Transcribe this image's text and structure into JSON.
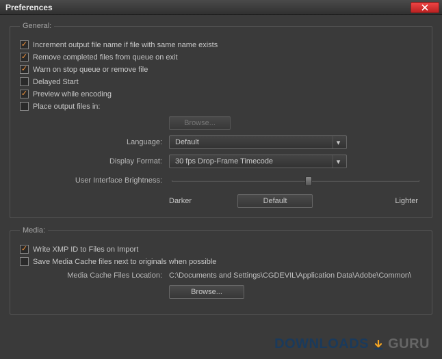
{
  "window": {
    "title": "Preferences"
  },
  "general": {
    "legend": "General:",
    "increment": {
      "label": "Increment output file name if file with same name exists",
      "checked": true
    },
    "remove": {
      "label": "Remove completed files from queue on exit",
      "checked": true
    },
    "warn": {
      "label": "Warn on stop queue or remove file",
      "checked": true
    },
    "delayed": {
      "label": "Delayed Start",
      "checked": false
    },
    "preview": {
      "label": "Preview while encoding",
      "checked": true
    },
    "place": {
      "label": "Place output files in:",
      "checked": false
    },
    "browse_label": "Browse...",
    "language_label": "Language:",
    "language_value": "Default",
    "display_format_label": "Display Format:",
    "display_format_value": "30 fps Drop-Frame Timecode",
    "brightness_label": "User Interface Brightness:",
    "darker_label": "Darker",
    "default_label": "Default",
    "lighter_label": "Lighter"
  },
  "media": {
    "legend": "Media:",
    "write_xmp": {
      "label": "Write XMP ID to Files on Import",
      "checked": true
    },
    "save_cache": {
      "label": "Save Media Cache files next to originals when possible",
      "checked": false
    },
    "location_label": "Media Cache Files Location:",
    "location_value": "C:\\Documents and Settings\\CGDEVIL\\Application Data\\Adobe\\Common\\",
    "browse_label": "Browse..."
  },
  "watermark": {
    "downloads": "DOWNLOADS",
    "guru": "GURU"
  }
}
